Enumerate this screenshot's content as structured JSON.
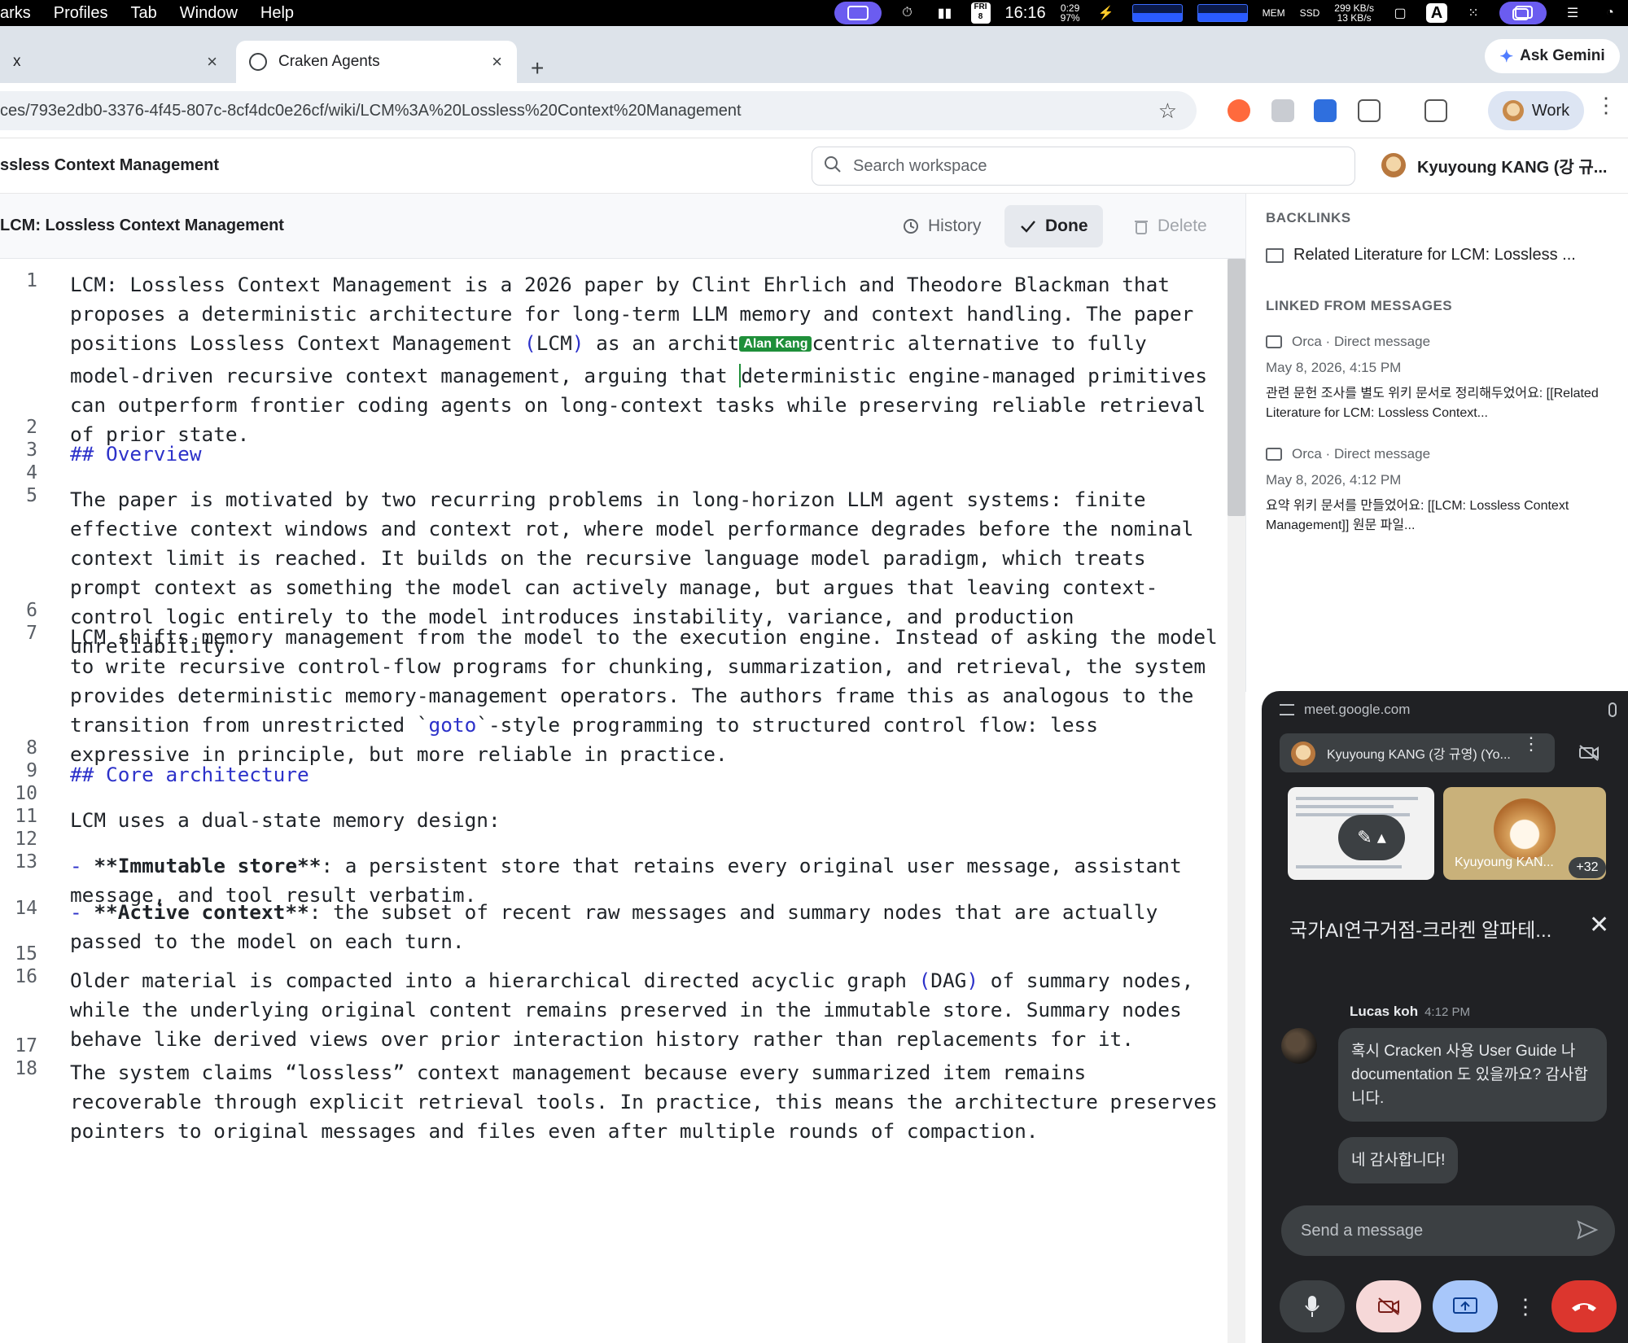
{
  "menubar": {
    "items": [
      "arks",
      "Profiles",
      "Tab",
      "Window",
      "Help"
    ],
    "date_day": "FRI",
    "date_num": "8",
    "clock": "16:16",
    "battery_time": "0:29",
    "battery_pct": "97%",
    "mem_label": "MEM",
    "ssd_label": "SSD",
    "net_up": "299 KB/s",
    "net_down": "13 KB/s",
    "input_letter": "A"
  },
  "tabs": {
    "inactive_label": "x",
    "active_label": "Craken Agents",
    "close_glyph": "×",
    "new_tab_glyph": "+",
    "gemini_label": "Ask Gemini"
  },
  "address": {
    "url": "ces/793e2db0-3376-4f45-807c-8cf4dc0e26cf/wiki/LCM%3A%20Lossless%20Context%20Management",
    "profile_label": "Work"
  },
  "app": {
    "title": "ssless Context Management",
    "search_placeholder": "Search workspace",
    "user_name": "Kyuyoung KANG (강 규..."
  },
  "doc": {
    "title": "LCM: Lossless Context Management",
    "history_label": "History",
    "done_label": "Done",
    "delete_label": "Delete",
    "collaborator_tag": "Alan Kang"
  },
  "editor_lines": [
    {
      "n": "1",
      "text": "LCM: Lossless Context Management is a 2026 paper by Clint Ehrlich and Theodore Blackman that proposes a deterministic architecture for long-term LLM memory and context handling. The paper positions Lossless Context Management (LCM) as an architecture-centric alternative to fully model-driven recursive context management, arguing that deterministic engine-managed primitives can outperform frontier coding agents on long-context tasks while preserving reliable retrieval of prior state."
    },
    {
      "n": "2",
      "text": ""
    },
    {
      "n": "3",
      "text": "## Overview"
    },
    {
      "n": "4",
      "text": ""
    },
    {
      "n": "5",
      "text": "The paper is motivated by two recurring problems in long-horizon LLM agent systems: finite effective context windows and context rot, where model performance degrades before the nominal context limit is reached. It builds on the recursive language model paradigm, which treats prompt context as something the model can actively manage, but argues that leaving context-control logic entirely to the model introduces instability, variance, and production unreliability."
    },
    {
      "n": "6",
      "text": ""
    },
    {
      "n": "7",
      "text": "LCM shifts memory management from the model to the execution engine. Instead of asking the model to write recursive control-flow programs for chunking, summarization, and retrieval, the system provides deterministic memory-management operators. The authors frame this as analogous to the transition from unrestricted `goto`-style programming to structured control flow: less expressive in principle, but more reliable in practice."
    },
    {
      "n": "8",
      "text": ""
    },
    {
      "n": "9",
      "text": "## Core architecture"
    },
    {
      "n": "10",
      "text": ""
    },
    {
      "n": "11",
      "text": "LCM uses a dual-state memory design:"
    },
    {
      "n": "12",
      "text": ""
    },
    {
      "n": "13",
      "text": "- **Immutable store**: a persistent store that retains every original user message, assistant message, and tool result verbatim."
    },
    {
      "n": "14",
      "text": "- **Active context**: the subset of recent raw messages and summary nodes that are actually passed to the model on each turn."
    },
    {
      "n": "15",
      "text": ""
    },
    {
      "n": "16",
      "text": "Older material is compacted into a hierarchical directed acyclic graph (DAG) of summary nodes, while the underlying original content remains preserved in the immutable store. Summary nodes behave like derived views over prior interaction history rather than replacements for it."
    },
    {
      "n": "17",
      "text": ""
    },
    {
      "n": "18",
      "text": "The system claims “lossless” context management because every summarized item remains recoverable through explicit retrieval tools. In practice, this means the architecture preserves pointers to original messages and files even after multiple rounds of compaction."
    }
  ],
  "panel": {
    "backlinks_heading": "BACKLINKS",
    "backlink_item": "Related Literature for LCM: Lossless ...",
    "linked_heading": "LINKED FROM MESSAGES",
    "messages": [
      {
        "source": "Orca · Direct message",
        "date": "May 8, 2026, 4:15 PM",
        "body": "관련 문헌 조사를 별도 위키 문서로 정리해두었어요: [[Related Literature for LCM: Lossless Context..."
      },
      {
        "source": "Orca · Direct message",
        "date": "May 8, 2026, 4:12 PM",
        "body": "요약 위키 문서를 만들었어요: [[LCM: Lossless Context Management]] 원문 파일..."
      }
    ]
  },
  "meet": {
    "domain": "meet.google.com",
    "participant": "Kyuyoung KANG (강 규영) (Yo...",
    "tile_name": "Kyuyoung KAN...",
    "more_count": "+32",
    "chat_title": "국가AI연구거점-크라켄 알파테...",
    "sender": "Lucas koh",
    "sent_time": "4:12 PM",
    "messages": [
      "혹시 Cracken 사용 User Guide 나 documentation 도 있을까요? 감사합니다.",
      "네 감사합니다!"
    ],
    "send_placeholder": "Send a message"
  }
}
